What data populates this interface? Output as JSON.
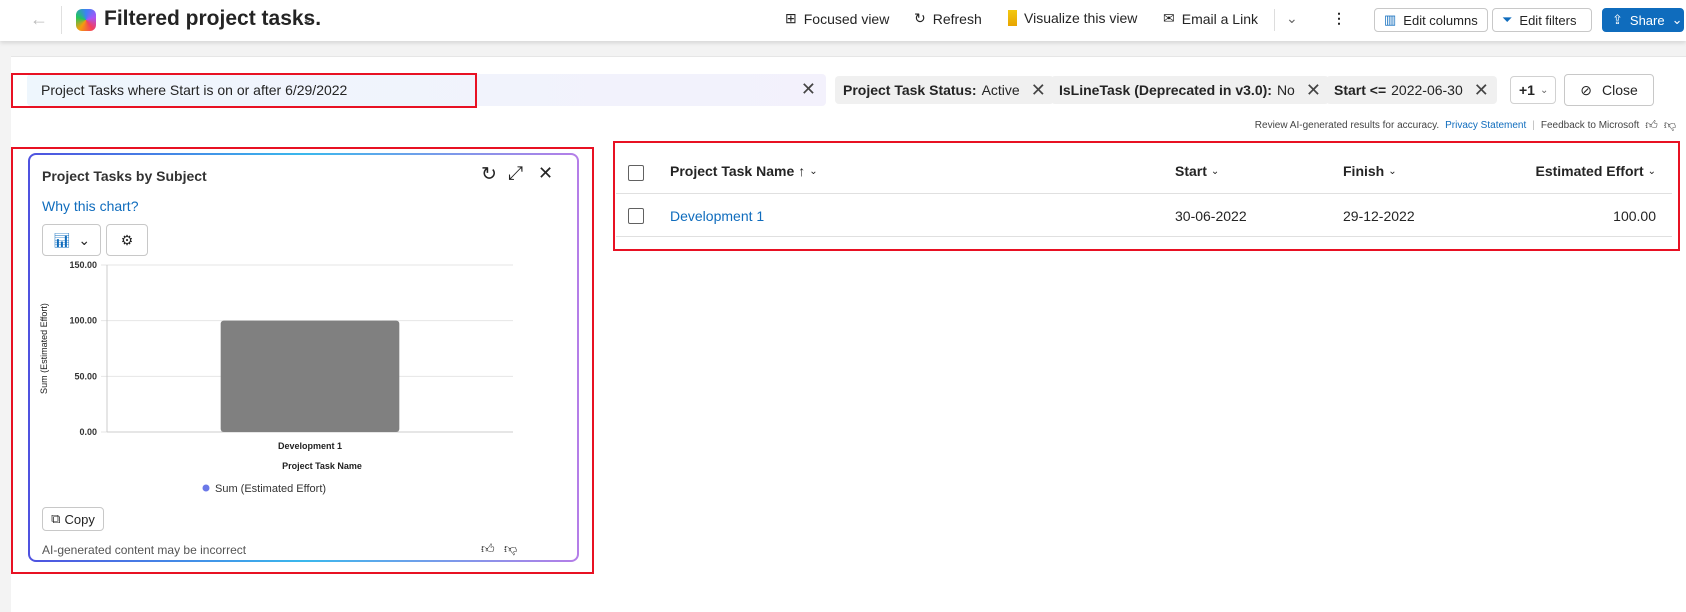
{
  "header": {
    "title": "Filtered project tasks.",
    "toolbar": {
      "focused_view": "Focused view",
      "refresh": "Refresh",
      "visualize": "Visualize this view",
      "email_link": "Email a Link",
      "edit_columns": "Edit columns",
      "edit_filters": "Edit filters",
      "share": "Share"
    }
  },
  "filterbar": {
    "query": "Project Tasks where Start is on or after 6/29/2022",
    "chips": [
      {
        "label": "Project Task Status:",
        "value": "Active"
      },
      {
        "label": "IsLineTask (Deprecated in v3.0):",
        "value": "No"
      },
      {
        "label": "Start <=",
        "value": "2022-06-30"
      }
    ],
    "more": "+1",
    "close": "Close"
  },
  "disclaimer": {
    "text": "Review AI-generated results for accuracy.",
    "privacy": "Privacy Statement",
    "feedback": "Feedback to Microsoft"
  },
  "chart_card": {
    "title": "Project Tasks by Subject",
    "why": "Why this chart?",
    "copy": "Copy",
    "footer": "AI-generated content may be incorrect"
  },
  "chart_data": {
    "type": "bar",
    "categories": [
      "Development 1"
    ],
    "series": [
      {
        "name": "Sum (Estimated Effort)",
        "values": [
          100
        ]
      }
    ],
    "xlabel": "Project Task Name",
    "ylabel": "Sum (Estimated Effort)",
    "ylim": [
      0,
      150
    ],
    "yticks": [
      "0.00",
      "50.00",
      "100.00",
      "150.00"
    ],
    "grid": true,
    "legend": "bottom",
    "colors": {
      "bar": "#808080",
      "legend_marker": "#6b78e8"
    }
  },
  "table": {
    "columns": [
      "Project Task Name",
      "Start",
      "Finish",
      "Estimated Effort"
    ],
    "rows": [
      {
        "name": "Development 1",
        "start": "30-06-2022",
        "finish": "29-12-2022",
        "effort": "100.00"
      }
    ]
  },
  "colors": {
    "accent": "#0f6cbd",
    "highlight": "#e81123"
  }
}
